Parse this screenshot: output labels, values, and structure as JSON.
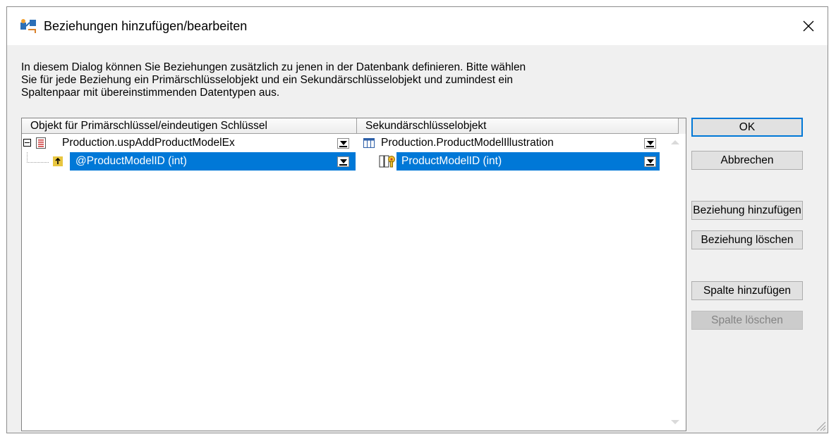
{
  "window": {
    "title": "Beziehungen hinzufügen/bearbeiten",
    "description": "In diesem Dialog können Sie Beziehungen zusätzlich zu jenen in der Datenbank definieren. Bitte wählen\nSie für jede Beziehung ein Primärschlüsselobjekt und ein Sekundärschlüsselobjekt und zumindest ein\nSpaltenpaar mit übereinstimmenden Datentypen aus."
  },
  "grid": {
    "columns": [
      "Objekt für Primärschlüssel/eindeutigen Schlüssel",
      "Sekundärschlüsselobjekt"
    ],
    "relation": {
      "primary_object": "Production.uspAddProductModelEx",
      "secondary_object": "Production.ProductModelIllustration",
      "column_pair": {
        "primary_column": "@ProductModelID (int)",
        "secondary_column": "ProductModelID (int)"
      }
    }
  },
  "buttons": {
    "ok": "OK",
    "cancel": "Abbrechen",
    "add_relation": "Beziehung hinzufügen",
    "delete_relation": "Beziehung löschen",
    "add_column": "Spalte hinzufügen",
    "delete_column": "Spalte löschen"
  },
  "icons": {
    "app": "relations-icon",
    "close": "close-icon",
    "procedure": "stored-procedure-icon",
    "table": "table-icon",
    "parameter": "parameter-icon",
    "foreign_key_column": "key-column-icon"
  },
  "colors": {
    "selection": "#0078d7",
    "dialog_background": "#f0f0f0",
    "default_button_border": "#0078d7"
  }
}
